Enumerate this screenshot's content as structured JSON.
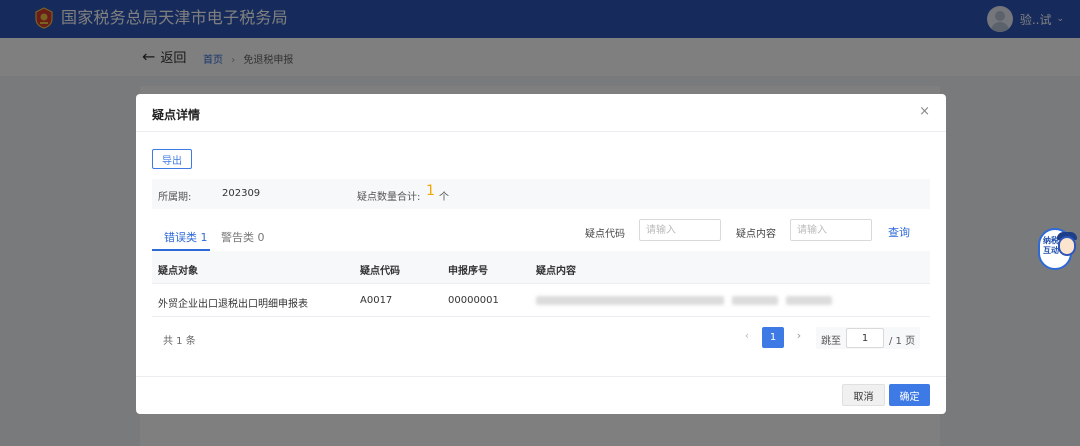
{
  "header": {
    "title": "国家税务总局天津市电子税务局",
    "user_name": "验..试",
    "user_caret": "⌄"
  },
  "subbar": {
    "back_label": "返回",
    "back_arrow": "←",
    "breadcrumb_home": "首页",
    "breadcrumb_sep": "›",
    "breadcrumb_current": "免退税申报"
  },
  "modal": {
    "title": "疑点详情",
    "close": "×",
    "export_label": "导出",
    "info": {
      "period_label": "所属期:",
      "period_value": "202309",
      "count_label": "疑点数量合计:",
      "count_value": "1",
      "count_unit": "个"
    },
    "tabs": [
      {
        "label": "错误类 1",
        "active": true
      },
      {
        "label": "警告类 0",
        "active": false
      }
    ],
    "filters": {
      "code_label": "疑点代码",
      "code_placeholder": "请输入",
      "content_label": "疑点内容",
      "content_placeholder": "请输入",
      "query_label": "查询"
    },
    "table": {
      "columns": [
        "疑点对象",
        "疑点代码",
        "申报序号",
        "疑点内容"
      ],
      "rows": [
        {
          "object": "外贸企业出口退税出口明细申报表",
          "code": "A0017",
          "seq": "00000001"
        }
      ]
    },
    "pagination": {
      "total": "共 1 条",
      "prev": "‹",
      "current_page": "1",
      "next": "›",
      "jump_label": "跳至",
      "jump_value": "1",
      "total_pages": "/ 1 页"
    },
    "footer": {
      "cancel_label": "取消",
      "ok_label": "确定"
    }
  },
  "widget": {
    "text": "纳税互动"
  },
  "colors": {
    "header_bg": "#2d56b8",
    "primary": "#3d7ae6",
    "count_accent": "#f2a600"
  }
}
